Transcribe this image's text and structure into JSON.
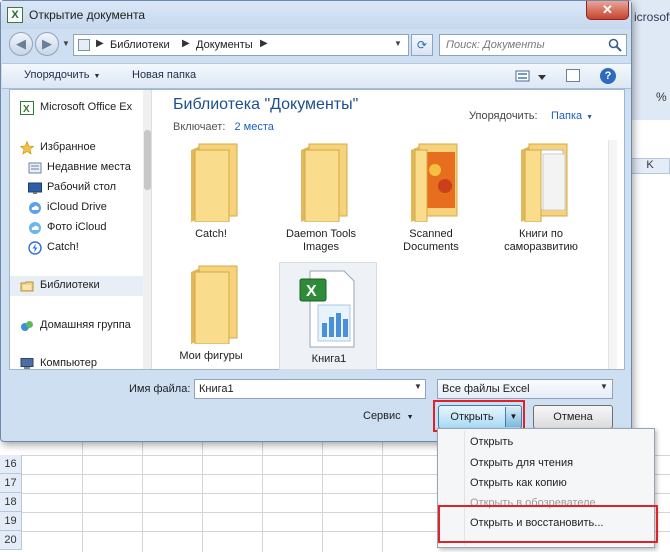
{
  "window": {
    "title": "Открытие документа",
    "close_label": "✕",
    "app_icon_letter": "X"
  },
  "address_bar": {
    "crumbs": [
      "Библиотеки",
      "Документы"
    ],
    "separator": "▶"
  },
  "search": {
    "placeholder": "Поиск: Документы"
  },
  "toolbar": {
    "organize_label": "Упорядочить",
    "new_folder_label": "Новая папка"
  },
  "nav_pane": {
    "items": [
      {
        "label": "Microsoft Office Ex",
        "icon": "excel-icon"
      },
      {
        "label": "Избранное",
        "icon": "star-icon"
      },
      {
        "label": "Недавние места",
        "icon": "recent-places-icon"
      },
      {
        "label": "Рабочий стол",
        "icon": "desktop-icon"
      },
      {
        "label": "iCloud Drive",
        "icon": "icloud-icon"
      },
      {
        "label": "Фото iCloud",
        "icon": "photo-icloud-icon"
      },
      {
        "label": "Catch!",
        "icon": "catch-icon"
      },
      {
        "label": "Библиотеки",
        "icon": "libraries-icon"
      },
      {
        "label": "Домашняя группа",
        "icon": "homegroup-icon"
      },
      {
        "label": "Компьютер",
        "icon": "computer-icon"
      }
    ]
  },
  "library": {
    "title": "Библиотека \"Документы\"",
    "includes_label": "Включает:",
    "includes_link": "2 места",
    "arrange_label": "Упорядочить:",
    "arrange_value": "Папка"
  },
  "files": [
    {
      "name": "Catch!",
      "type": "folder"
    },
    {
      "name": "Daemon Tools Images",
      "type": "folder"
    },
    {
      "name": "Scanned Documents",
      "type": "folder-photo"
    },
    {
      "name": "Книги по саморазвитию",
      "type": "folder-docs"
    },
    {
      "name": "Мои фигуры",
      "type": "folder"
    },
    {
      "name": "Книга1",
      "type": "excel-file"
    }
  ],
  "bottom": {
    "filename_label": "Имя файла:",
    "filename_value": "Книга1",
    "filetype_value": "Все файлы Excel",
    "tools_label": "Сервис",
    "open_label": "Открыть",
    "cancel_label": "Отмена"
  },
  "open_menu": {
    "items": [
      {
        "label": "Открыть",
        "enabled": true
      },
      {
        "label": "Открыть для чтения",
        "enabled": true
      },
      {
        "label": "Открыть как копию",
        "enabled": true
      },
      {
        "label": "Открыть в обозревателе",
        "enabled": false
      },
      {
        "label": "Открыть и восстановить...",
        "enabled": true
      }
    ]
  },
  "excel_background": {
    "ribbon_text": "icrosoft",
    "ribbon_percent": "%",
    "column_letter": "K",
    "row_numbers": [
      "16",
      "17",
      "18",
      "19",
      "20"
    ]
  },
  "colors": {
    "accent_red": "#e0222a",
    "link_blue": "#1f5fbf",
    "title_blue": "#1c4f8c"
  }
}
